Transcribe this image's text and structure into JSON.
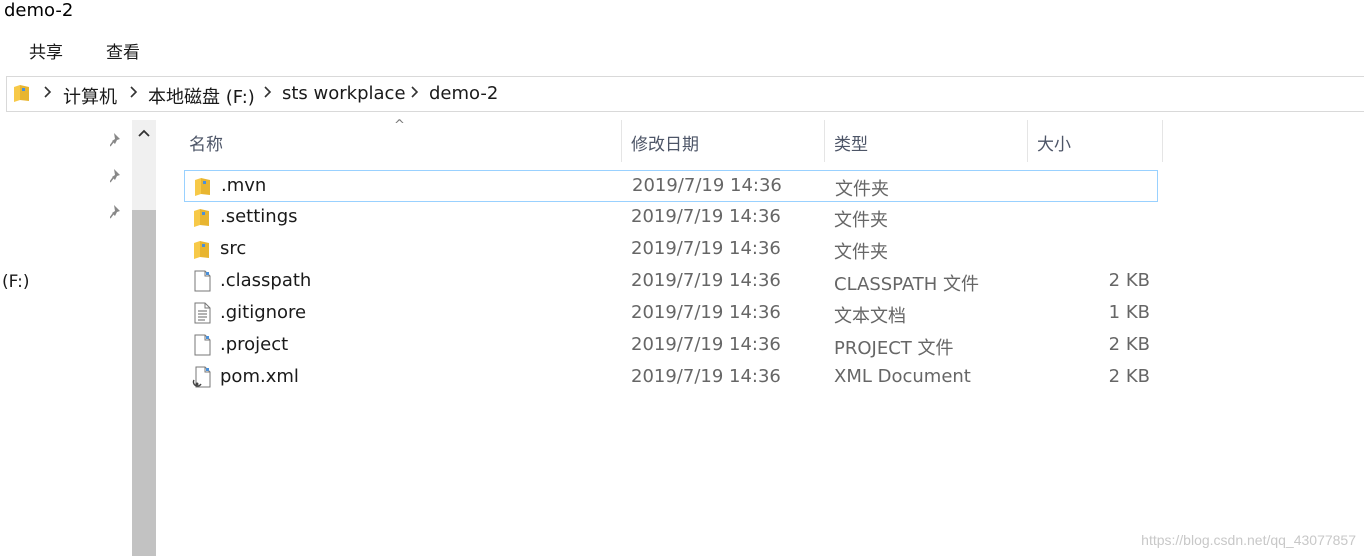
{
  "window": {
    "title": "demo-2"
  },
  "ribbon": {
    "tabs": [
      "共享",
      "查看"
    ]
  },
  "address": {
    "crumbs": [
      "计算机",
      "本地磁盘 (F:)",
      "sts workplace",
      "demo-2"
    ]
  },
  "nav": {
    "drive_label": "(F:)"
  },
  "columns": {
    "name": "名称",
    "date": "修改日期",
    "type": "类型",
    "size": "大小"
  },
  "files": [
    {
      "name": ".mvn",
      "date": "2019/7/19 14:36",
      "type": "文件夹",
      "size": "",
      "icon": "folder-icon"
    },
    {
      "name": ".settings",
      "date": "2019/7/19 14:36",
      "type": "文件夹",
      "size": "",
      "icon": "folder-icon"
    },
    {
      "name": "src",
      "date": "2019/7/19 14:36",
      "type": "文件夹",
      "size": "",
      "icon": "folder-icon"
    },
    {
      "name": ".classpath",
      "date": "2019/7/19 14:36",
      "type": "CLASSPATH 文件",
      "size": "2 KB",
      "icon": "file-icon"
    },
    {
      "name": ".gitignore",
      "date": "2019/7/19 14:36",
      "type": "文本文档",
      "size": "1 KB",
      "icon": "text-document-icon"
    },
    {
      "name": ".project",
      "date": "2019/7/19 14:36",
      "type": "PROJECT 文件",
      "size": "2 KB",
      "icon": "file-icon"
    },
    {
      "name": "pom.xml",
      "date": "2019/7/19 14:36",
      "type": "XML Document",
      "size": "2 KB",
      "icon": "xml-file-icon"
    }
  ],
  "watermark": "https://blog.csdn.net/qq_43077857",
  "colors": {
    "selection_border": "#99d1ff",
    "folder_yellow": "#f7c948",
    "scroll_thumb": "#c2c2c2"
  }
}
